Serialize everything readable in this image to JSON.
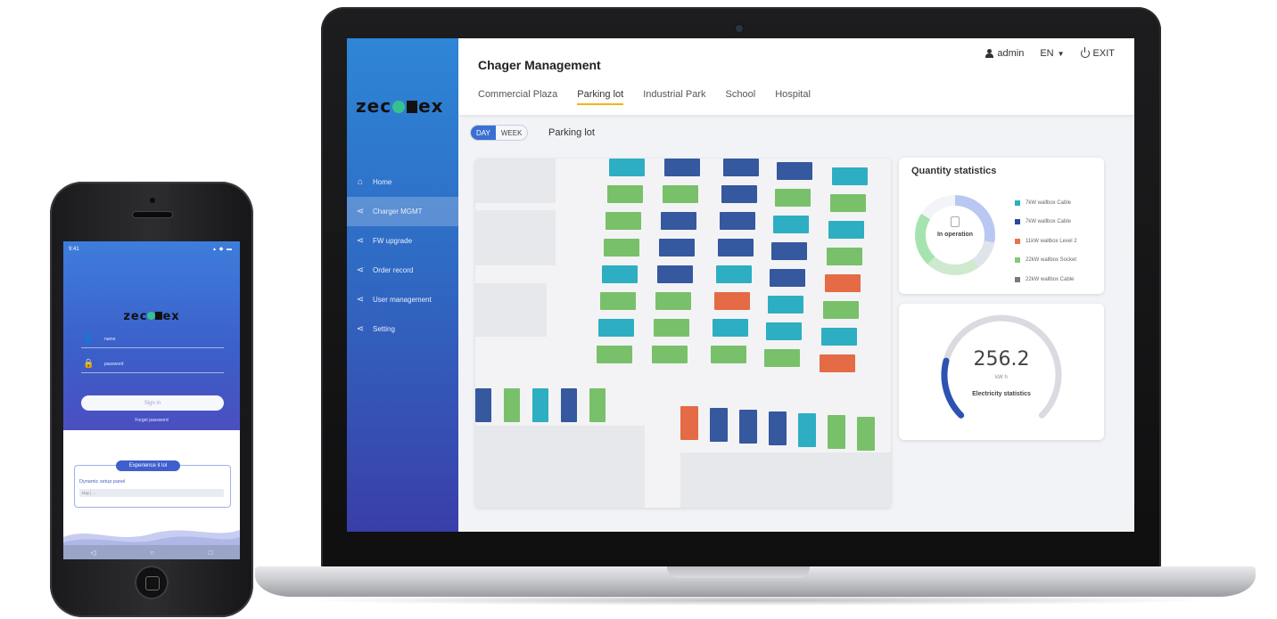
{
  "laptop": {
    "brand": "zeconex",
    "header": {
      "title": "Chager Management",
      "user": "admin",
      "lang": "EN",
      "exit": "EXIT"
    },
    "tabs": [
      {
        "label": "Commercial Plaza"
      },
      {
        "label": "Parking lot"
      },
      {
        "label": "Industrial Park"
      },
      {
        "label": "School"
      },
      {
        "label": "Hospital"
      }
    ],
    "active_tab": "Parking lot",
    "sidebar": [
      {
        "label": "Home",
        "icon": "home-icon"
      },
      {
        "label": "Charger MGMT",
        "icon": "share-icon"
      },
      {
        "label": "FW upgrade",
        "icon": "share-icon"
      },
      {
        "label": "Order record",
        "icon": "share-icon"
      },
      {
        "label": "User management",
        "icon": "share-icon"
      },
      {
        "label": "Setting",
        "icon": "share-icon"
      }
    ],
    "toggle": {
      "day": "DAY",
      "week": "WEEK",
      "selected": "DAY"
    },
    "sub_title": "Parking lot",
    "quantity_stats": {
      "title": "Quantity statistics",
      "center_label": "In operation",
      "legend": [
        {
          "label": "7kW wallbox Cable",
          "color": "#2eaec2"
        },
        {
          "label": "7kW wallbox Cable",
          "color": "#2b4a9a"
        },
        {
          "label": "11kW wallbox Level 2",
          "color": "#e8724a"
        },
        {
          "label": "22kW wallbox Socket",
          "color": "#88c878"
        },
        {
          "label": "22kW wallbox Cable",
          "color": "#7a7a7a"
        }
      ]
    },
    "electricity_stats": {
      "value": "256.2",
      "unit": "kW h",
      "label": "Electricity statistics",
      "fill_fraction": 0.22
    }
  },
  "phone": {
    "status_time": "9:41",
    "status_icons": "▴ ◆ ▬",
    "brand": "zeconex",
    "username_placeholder": "name",
    "password_placeholder": "password",
    "signin_label": "Sign in",
    "forgot_label": "Forget password",
    "experience_label": "Experience it lol",
    "dynamic_label": "Dynamic setup panel",
    "input_value": "Day | ...",
    "nav": [
      "◁",
      "○",
      "□"
    ]
  },
  "colors": {
    "green": "#79c06a",
    "teal": "#2eaec2",
    "navy": "#35589f",
    "orange": "#e46b45",
    "accent_tab": "#f2b416",
    "toggle_on": "#3b6fd1",
    "gauge_fill": "#2d52b3"
  }
}
